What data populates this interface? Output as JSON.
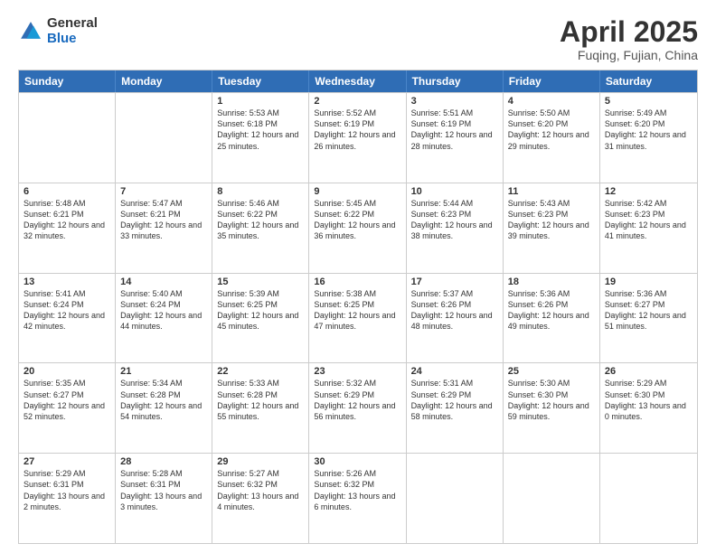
{
  "logo": {
    "general": "General",
    "blue": "Blue"
  },
  "title": {
    "month": "April 2025",
    "location": "Fuqing, Fujian, China"
  },
  "weekdays": [
    "Sunday",
    "Monday",
    "Tuesday",
    "Wednesday",
    "Thursday",
    "Friday",
    "Saturday"
  ],
  "weeks": [
    [
      {
        "day": "",
        "info": ""
      },
      {
        "day": "",
        "info": ""
      },
      {
        "day": "1",
        "info": "Sunrise: 5:53 AM\nSunset: 6:18 PM\nDaylight: 12 hours and 25 minutes."
      },
      {
        "day": "2",
        "info": "Sunrise: 5:52 AM\nSunset: 6:19 PM\nDaylight: 12 hours and 26 minutes."
      },
      {
        "day": "3",
        "info": "Sunrise: 5:51 AM\nSunset: 6:19 PM\nDaylight: 12 hours and 28 minutes."
      },
      {
        "day": "4",
        "info": "Sunrise: 5:50 AM\nSunset: 6:20 PM\nDaylight: 12 hours and 29 minutes."
      },
      {
        "day": "5",
        "info": "Sunrise: 5:49 AM\nSunset: 6:20 PM\nDaylight: 12 hours and 31 minutes."
      }
    ],
    [
      {
        "day": "6",
        "info": "Sunrise: 5:48 AM\nSunset: 6:21 PM\nDaylight: 12 hours and 32 minutes."
      },
      {
        "day": "7",
        "info": "Sunrise: 5:47 AM\nSunset: 6:21 PM\nDaylight: 12 hours and 33 minutes."
      },
      {
        "day": "8",
        "info": "Sunrise: 5:46 AM\nSunset: 6:22 PM\nDaylight: 12 hours and 35 minutes."
      },
      {
        "day": "9",
        "info": "Sunrise: 5:45 AM\nSunset: 6:22 PM\nDaylight: 12 hours and 36 minutes."
      },
      {
        "day": "10",
        "info": "Sunrise: 5:44 AM\nSunset: 6:23 PM\nDaylight: 12 hours and 38 minutes."
      },
      {
        "day": "11",
        "info": "Sunrise: 5:43 AM\nSunset: 6:23 PM\nDaylight: 12 hours and 39 minutes."
      },
      {
        "day": "12",
        "info": "Sunrise: 5:42 AM\nSunset: 6:23 PM\nDaylight: 12 hours and 41 minutes."
      }
    ],
    [
      {
        "day": "13",
        "info": "Sunrise: 5:41 AM\nSunset: 6:24 PM\nDaylight: 12 hours and 42 minutes."
      },
      {
        "day": "14",
        "info": "Sunrise: 5:40 AM\nSunset: 6:24 PM\nDaylight: 12 hours and 44 minutes."
      },
      {
        "day": "15",
        "info": "Sunrise: 5:39 AM\nSunset: 6:25 PM\nDaylight: 12 hours and 45 minutes."
      },
      {
        "day": "16",
        "info": "Sunrise: 5:38 AM\nSunset: 6:25 PM\nDaylight: 12 hours and 47 minutes."
      },
      {
        "day": "17",
        "info": "Sunrise: 5:37 AM\nSunset: 6:26 PM\nDaylight: 12 hours and 48 minutes."
      },
      {
        "day": "18",
        "info": "Sunrise: 5:36 AM\nSunset: 6:26 PM\nDaylight: 12 hours and 49 minutes."
      },
      {
        "day": "19",
        "info": "Sunrise: 5:36 AM\nSunset: 6:27 PM\nDaylight: 12 hours and 51 minutes."
      }
    ],
    [
      {
        "day": "20",
        "info": "Sunrise: 5:35 AM\nSunset: 6:27 PM\nDaylight: 12 hours and 52 minutes."
      },
      {
        "day": "21",
        "info": "Sunrise: 5:34 AM\nSunset: 6:28 PM\nDaylight: 12 hours and 54 minutes."
      },
      {
        "day": "22",
        "info": "Sunrise: 5:33 AM\nSunset: 6:28 PM\nDaylight: 12 hours and 55 minutes."
      },
      {
        "day": "23",
        "info": "Sunrise: 5:32 AM\nSunset: 6:29 PM\nDaylight: 12 hours and 56 minutes."
      },
      {
        "day": "24",
        "info": "Sunrise: 5:31 AM\nSunset: 6:29 PM\nDaylight: 12 hours and 58 minutes."
      },
      {
        "day": "25",
        "info": "Sunrise: 5:30 AM\nSunset: 6:30 PM\nDaylight: 12 hours and 59 minutes."
      },
      {
        "day": "26",
        "info": "Sunrise: 5:29 AM\nSunset: 6:30 PM\nDaylight: 13 hours and 0 minutes."
      }
    ],
    [
      {
        "day": "27",
        "info": "Sunrise: 5:29 AM\nSunset: 6:31 PM\nDaylight: 13 hours and 2 minutes."
      },
      {
        "day": "28",
        "info": "Sunrise: 5:28 AM\nSunset: 6:31 PM\nDaylight: 13 hours and 3 minutes."
      },
      {
        "day": "29",
        "info": "Sunrise: 5:27 AM\nSunset: 6:32 PM\nDaylight: 13 hours and 4 minutes."
      },
      {
        "day": "30",
        "info": "Sunrise: 5:26 AM\nSunset: 6:32 PM\nDaylight: 13 hours and 6 minutes."
      },
      {
        "day": "",
        "info": ""
      },
      {
        "day": "",
        "info": ""
      },
      {
        "day": "",
        "info": ""
      }
    ]
  ]
}
